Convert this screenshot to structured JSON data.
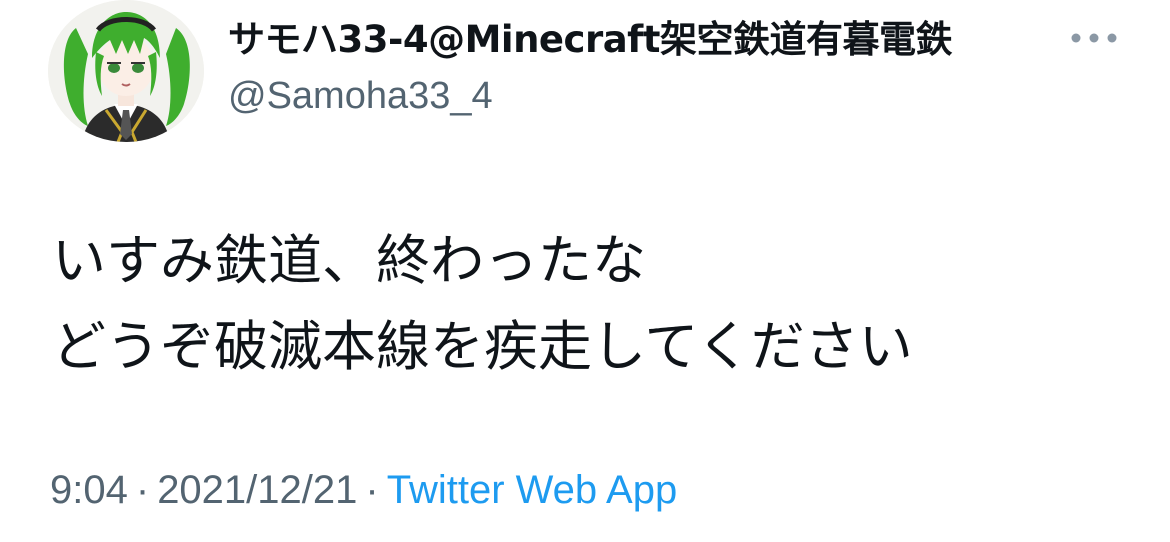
{
  "user": {
    "display_name": "サモハ33-4@Minecraft架空鉄道有暮電鉄",
    "handle": "@Samoha33_4",
    "avatar_icon": "anime-avatar-green-twintails"
  },
  "header": {
    "more_icon": "more-horizontal-icon"
  },
  "tweet": {
    "lines": [
      "いすみ鉄道、終わったな",
      "どうぞ破滅本線を疾走してください"
    ]
  },
  "meta": {
    "time": "9:04",
    "separator": "·",
    "date": "2021/12/21",
    "source": "Twitter Web App"
  },
  "colors": {
    "text_primary": "#0f1419",
    "text_secondary": "#536471",
    "link": "#1d9bf0",
    "avatar_hair": "#3fae2e",
    "more_dots": "#8b98a5"
  }
}
